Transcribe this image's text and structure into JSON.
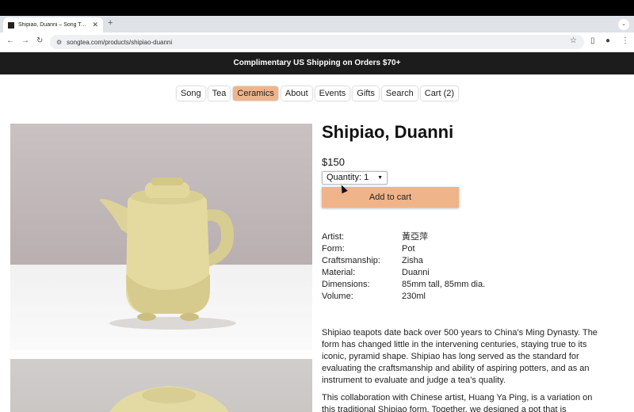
{
  "browser": {
    "tab_title": "Shipiao, Duanni – Song Tea & Ceramics",
    "new_tab": "+",
    "url": "songtea.com/products/shipiao-duanni"
  },
  "promo": "Complimentary US Shipping on Orders $70+",
  "nav": [
    {
      "label": "Song",
      "active": false
    },
    {
      "label": "Tea",
      "active": false
    },
    {
      "label": "Ceramics",
      "active": true
    },
    {
      "label": "About",
      "active": false
    },
    {
      "label": "Events",
      "active": false
    },
    {
      "label": "Gifts",
      "active": false
    },
    {
      "label": "Search",
      "active": false
    },
    {
      "label": "Cart (2)",
      "active": false
    }
  ],
  "product": {
    "title": "Shipiao, Duanni",
    "price": "$150",
    "quantity_label": "Quantity:",
    "quantity_value": "1",
    "add_to_cart": "Add to cart",
    "specs": [
      {
        "key": "Artist:",
        "value": "黃亞萍"
      },
      {
        "key": "Form:",
        "value": "Pot"
      },
      {
        "key": "Craftsmanship:",
        "value": "Zisha"
      },
      {
        "key": "Material:",
        "value": "Duanni"
      },
      {
        "key": "Dimensions:",
        "value": "85mm tall, 85mm dia."
      },
      {
        "key": "Volume:",
        "value": "230ml"
      }
    ],
    "description": [
      "Shipiao teapots date back over 500 years to China’s Ming Dynasty. The form has changed little in the intervening centuries, staying true to its iconic, pyramid shape. Shipiao has long served as the standard for evaluating the craftsmanship and ability of aspiring potters, and as an instrument to evaluate and judge a tea’s quality.",
      "This collaboration with Chinese artist, Huang Ya Ping, is a variation on this traditional Shipiao form. Together, we designed a pot that is"
    ]
  },
  "colors": {
    "accent": "#f0b48a",
    "promo_bg": "#1c1c1c"
  }
}
